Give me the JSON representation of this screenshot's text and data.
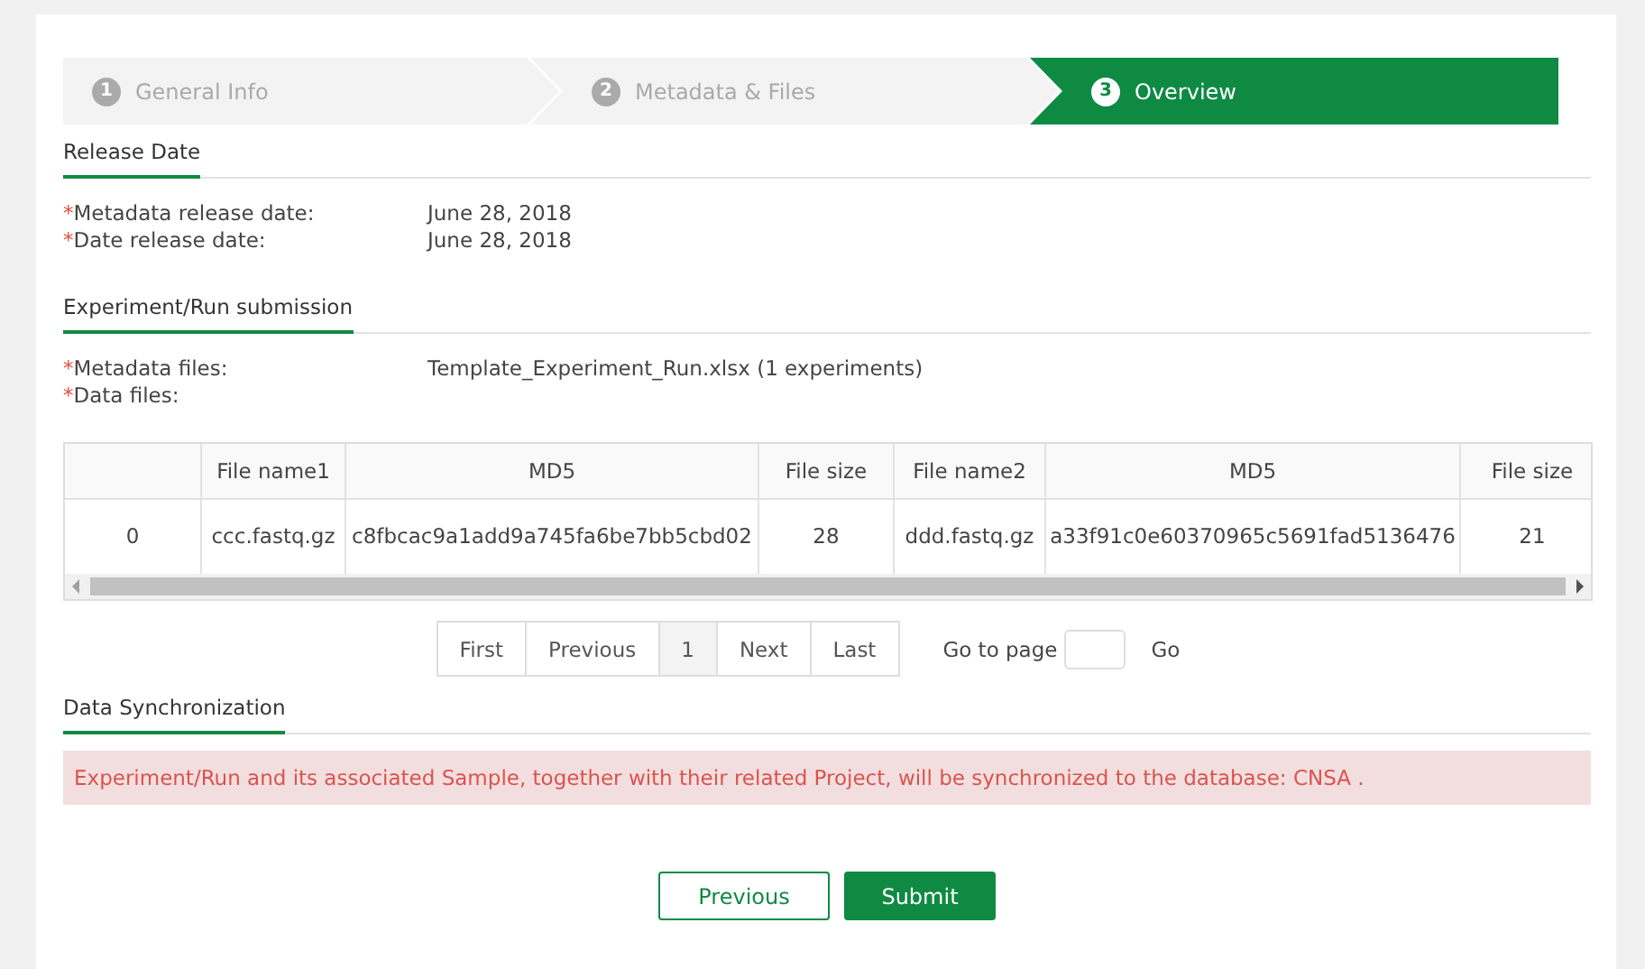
{
  "steps": [
    {
      "number": "1",
      "label": "General Info",
      "selected": false
    },
    {
      "number": "2",
      "label": "Metadata & Files",
      "selected": false
    },
    {
      "number": "3",
      "label": "Overview",
      "selected": true
    }
  ],
  "release_date": {
    "title": "Release Date",
    "fields": [
      {
        "mark": "*",
        "label": "Metadata release date:",
        "value": "June 28, 2018"
      },
      {
        "mark": "*",
        "label": "Date release date:",
        "value": "June 28, 2018"
      }
    ]
  },
  "submission": {
    "title": "Experiment/Run submission",
    "fields": [
      {
        "mark": "*",
        "label": "Metadata files:",
        "value": "Template_Experiment_Run.xlsx (1 experiments)"
      },
      {
        "mark": "*",
        "label": "Data files:"
      }
    ]
  },
  "table": {
    "columns": [
      "",
      "File name1",
      "MD5",
      "File size",
      "File name2",
      "MD5",
      "File size"
    ],
    "rows": [
      [
        "0",
        "ccc.fastq.gz",
        "c8fbcac9a1add9a745fa6be7bb5cbd02",
        "28",
        "ddd.fastq.gz",
        "a33f91c0e60370965c5691fad5136476",
        "21"
      ]
    ]
  },
  "pagination": {
    "buttons": [
      {
        "label": "First",
        "selected": false
      },
      {
        "label": "Previous",
        "selected": false
      },
      {
        "label": "1",
        "selected": true
      },
      {
        "label": "Next",
        "selected": false
      },
      {
        "label": "Last",
        "selected": false
      }
    ],
    "goto_label": "Go to page",
    "go": "Go"
  },
  "sync": {
    "title": "Data Synchronization",
    "message": "Experiment/Run and its associated Sample, together with their related Project, will be synchronized to the database: CNSA ."
  },
  "buttons": {
    "previous": "Previous",
    "submit": "Submit"
  }
}
